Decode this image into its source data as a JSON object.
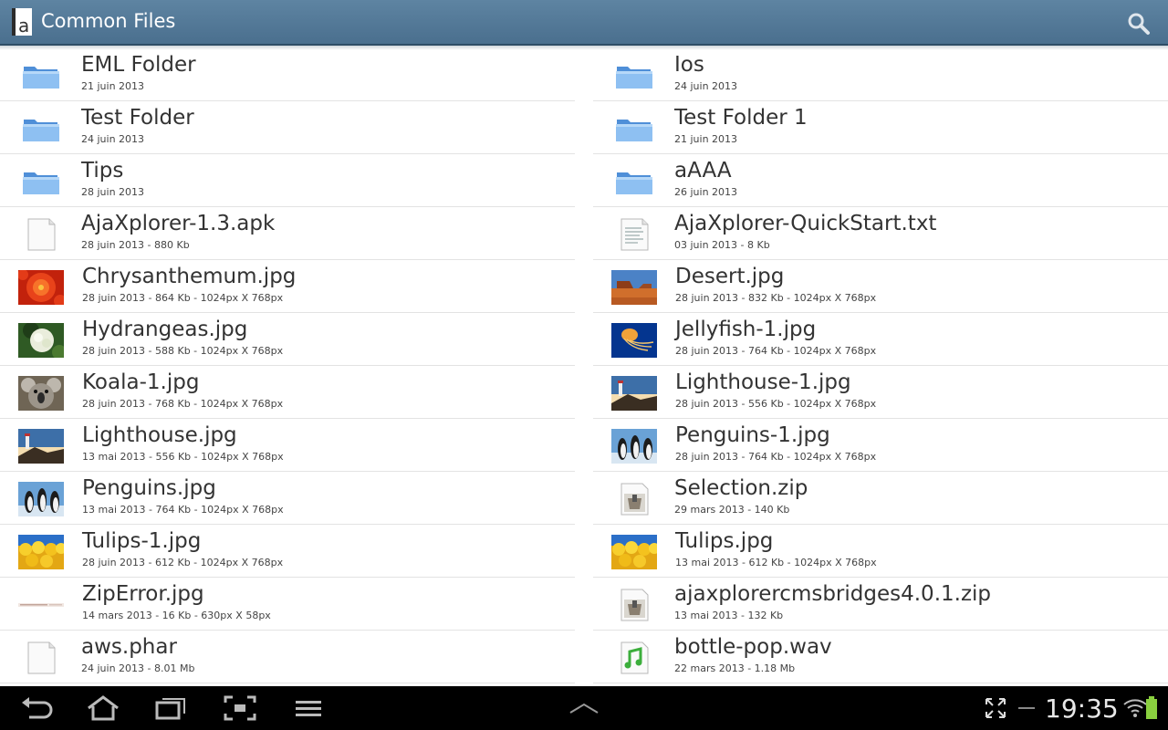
{
  "app": {
    "title": "Common Files",
    "accent": "#4f7594"
  },
  "files": {
    "left": [
      {
        "name": "EML Folder",
        "meta": "21 juin 2013",
        "icon": "folder-icon",
        "kind": "folder"
      },
      {
        "name": "Test Folder",
        "meta": "24 juin 2013",
        "icon": "folder-icon",
        "kind": "folder"
      },
      {
        "name": "Tips",
        "meta": "28 juin 2013",
        "icon": "folder-icon",
        "kind": "folder"
      },
      {
        "name": "AjaXplorer-1.3.apk",
        "meta": "28 juin 2013 - 880 Kb",
        "icon": "file-icon",
        "kind": "file"
      },
      {
        "name": "Chrysanthemum.jpg",
        "meta": "28 juin 2013 - 864 Kb - 1024px X 768px",
        "icon": "flower-thumbnail",
        "kind": "chrysanthemum"
      },
      {
        "name": "Hydrangeas.jpg",
        "meta": "28 juin 2013 - 588 Kb - 1024px X 768px",
        "icon": "hydrangea-thumbnail",
        "kind": "hydrangea"
      },
      {
        "name": "Koala-1.jpg",
        "meta": "28 juin 2013 - 768 Kb - 1024px X 768px",
        "icon": "koala-thumbnail",
        "kind": "koala"
      },
      {
        "name": "Lighthouse.jpg",
        "meta": "13 mai 2013 - 556 Kb - 1024px X 768px",
        "icon": "lighthouse-thumbnail",
        "kind": "lighthouse"
      },
      {
        "name": "Penguins.jpg",
        "meta": "13 mai 2013 - 764 Kb - 1024px X 768px",
        "icon": "penguins-thumbnail",
        "kind": "penguins"
      },
      {
        "name": "Tulips-1.jpg",
        "meta": "28 juin 2013 - 612 Kb - 1024px X 768px",
        "icon": "tulips-thumbnail",
        "kind": "tulips"
      },
      {
        "name": "ZipError.jpg",
        "meta": "14 mars 2013 - 16 Kb - 630px X 58px",
        "icon": "banner-thumbnail",
        "kind": "ziperror"
      },
      {
        "name": "aws.phar",
        "meta": "24 juin 2013 - 8.01 Mb",
        "icon": "file-icon",
        "kind": "file"
      }
    ],
    "right": [
      {
        "name": "Ios",
        "meta": "24 juin 2013",
        "icon": "folder-icon",
        "kind": "folder"
      },
      {
        "name": "Test Folder 1",
        "meta": "21 juin 2013",
        "icon": "folder-icon",
        "kind": "folder"
      },
      {
        "name": "aAAA",
        "meta": "26 juin 2013",
        "icon": "folder-icon",
        "kind": "folder"
      },
      {
        "name": "AjaXplorer-QuickStart.txt",
        "meta": "03 juin 2013 - 8 Kb",
        "icon": "text-file-icon",
        "kind": "text"
      },
      {
        "name": "Desert.jpg",
        "meta": "28 juin 2013 - 832 Kb - 1024px X 768px",
        "icon": "desert-thumbnail",
        "kind": "desert"
      },
      {
        "name": "Jellyfish-1.jpg",
        "meta": "28 juin 2013 - 764 Kb - 1024px X 768px",
        "icon": "jellyfish-thumbnail",
        "kind": "jellyfish"
      },
      {
        "name": "Lighthouse-1.jpg",
        "meta": "28 juin 2013 - 556 Kb - 1024px X 768px",
        "icon": "lighthouse-thumbnail",
        "kind": "lighthouse"
      },
      {
        "name": "Penguins-1.jpg",
        "meta": "28 juin 2013 - 764 Kb - 1024px X 768px",
        "icon": "penguins-thumbnail",
        "kind": "penguins"
      },
      {
        "name": "Selection.zip",
        "meta": "29 mars 2013 - 140 Kb",
        "icon": "zip-icon",
        "kind": "zip"
      },
      {
        "name": "Tulips.jpg",
        "meta": "13 mai 2013 - 612 Kb - 1024px X 768px",
        "icon": "tulips-thumbnail",
        "kind": "tulips"
      },
      {
        "name": "ajaxplorercmsbridges4.0.1.zip",
        "meta": "13 mai 2013 - 132 Kb",
        "icon": "zip-icon",
        "kind": "zip"
      },
      {
        "name": "bottle-pop.wav",
        "meta": "22 mars 2013 - 1.18 Mb",
        "icon": "audio-file-icon",
        "kind": "audio"
      }
    ]
  },
  "status": {
    "time": "19:35"
  }
}
